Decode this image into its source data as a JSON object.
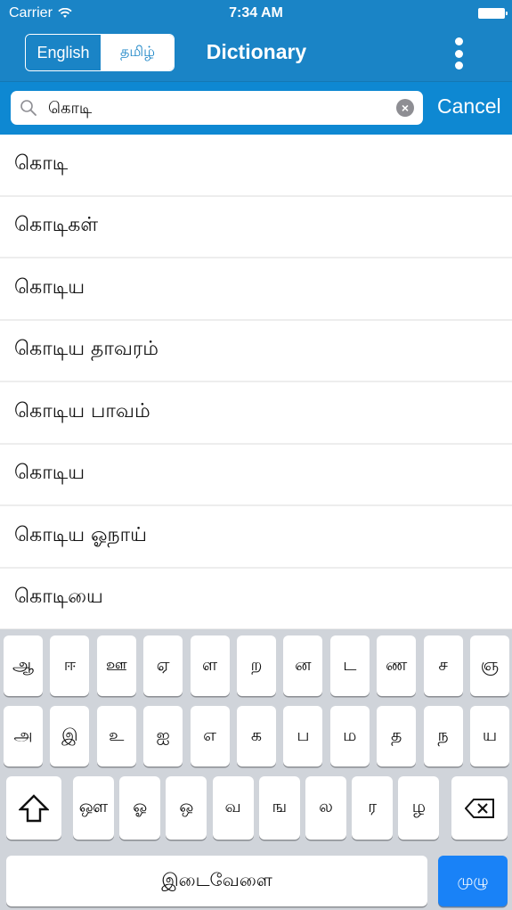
{
  "status_bar": {
    "carrier": "Carrier",
    "wifi_icon": "wifi-icon",
    "time": "7:34 AM",
    "battery_icon": "battery-icon"
  },
  "header": {
    "language_toggle": {
      "options": [
        "English",
        "தமிழ்"
      ],
      "selected": "English"
    },
    "title": "Dictionary",
    "more_icon": "more-vertical-icon"
  },
  "search": {
    "icon": "search-icon",
    "value": "கொடி",
    "placeholder": "",
    "clear_icon": "clear-icon",
    "cancel_label": "Cancel"
  },
  "results": [
    {
      "word": "கொடி"
    },
    {
      "word": "கொடிகள்"
    },
    {
      "word": "கொடிய"
    },
    {
      "word": "கொடிய தாவரம்"
    },
    {
      "word": "கொடிய பாவம்"
    },
    {
      "word": "கொடிய"
    },
    {
      "word": "கொடிய ஓநாய்"
    },
    {
      "word": "கொடியை"
    }
  ],
  "keyboard": {
    "row1": [
      "ஆ",
      "ஈ",
      "ஊ",
      "ஏ",
      "ள",
      "ற",
      "ன",
      "ட",
      "ண",
      "ச",
      "ஞ"
    ],
    "row2": [
      "அ",
      "இ",
      "உ",
      "ஐ",
      "எ",
      "க",
      "ப",
      "ம",
      "த",
      "ந",
      "ய"
    ],
    "row3": [
      "ஔ",
      "ஓ",
      "ஒ",
      "வ",
      "ங",
      "ல",
      "ர",
      "ழ"
    ],
    "shift_icon": "shift-icon",
    "backspace_icon": "backspace-icon",
    "space_label": "இடைவேளை",
    "return_label": "முழு"
  },
  "colors": {
    "header": "#1a84c6",
    "search_band": "#0e88d2",
    "return_key": "#1982f7",
    "keyboard_bg": "#d0d4da"
  }
}
